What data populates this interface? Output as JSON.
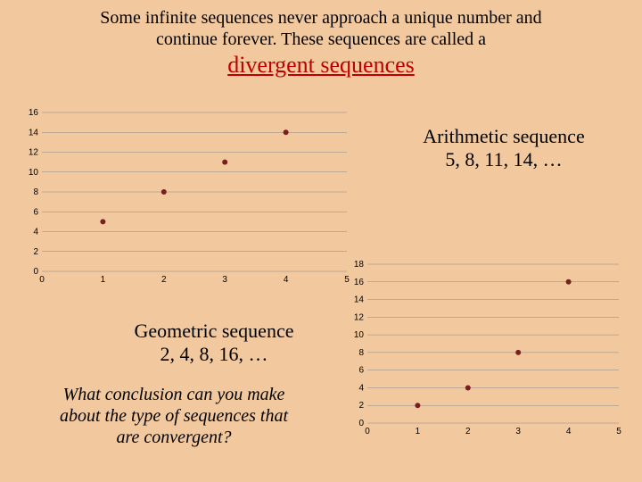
{
  "intro_line1": "Some infinite sequences never approach a unique number and",
  "intro_line2": "continue forever.  These sequences are called a",
  "divergent_title": "divergent sequences",
  "arith": {
    "title": "Arithmetic sequence",
    "terms": "5, 8, 11, 14, …"
  },
  "geom": {
    "title": "Geometric sequence",
    "terms": "2, 4, 8, 16, …"
  },
  "question_l1": "What conclusion can you make",
  "question_l2": "about the type of sequences that",
  "question_l3": "are convergent?",
  "chart_data": [
    {
      "type": "scatter",
      "name": "arithmetic",
      "x": [
        1,
        2,
        3,
        4
      ],
      "values": [
        5,
        8,
        11,
        14
      ],
      "xlim": [
        0,
        5
      ],
      "ylim": [
        0,
        16
      ],
      "yticks": [
        0,
        2,
        4,
        6,
        8,
        10,
        12,
        14,
        16
      ],
      "xticks": [
        0,
        1,
        2,
        3,
        4,
        5
      ],
      "xlabel": "",
      "ylabel": "",
      "title": ""
    },
    {
      "type": "scatter",
      "name": "geometric",
      "x": [
        1,
        2,
        3,
        4
      ],
      "values": [
        2,
        4,
        8,
        16
      ],
      "xlim": [
        0,
        5
      ],
      "ylim": [
        0,
        18
      ],
      "yticks": [
        0,
        2,
        4,
        6,
        8,
        10,
        12,
        14,
        16,
        18
      ],
      "xticks": [
        0,
        1,
        2,
        3,
        4,
        5
      ],
      "xlabel": "",
      "ylabel": "",
      "title": ""
    }
  ]
}
